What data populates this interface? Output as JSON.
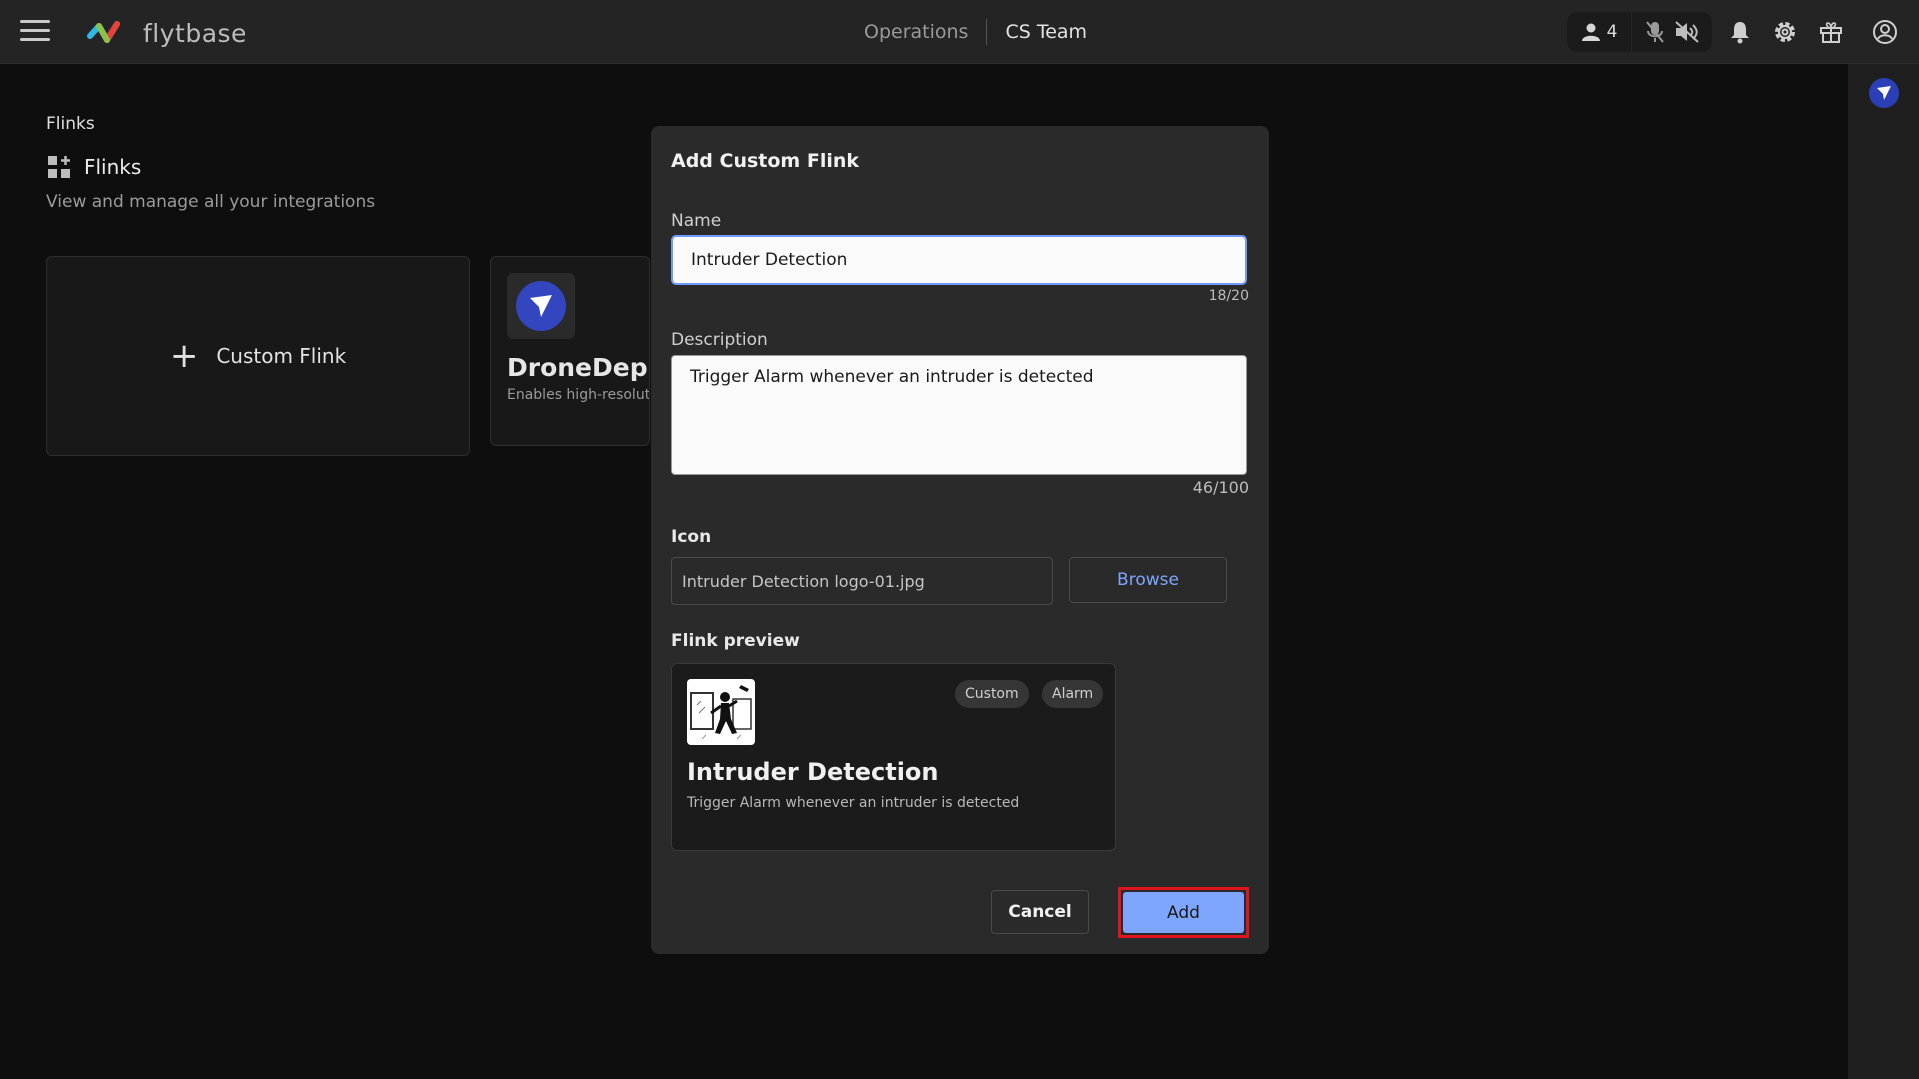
{
  "header": {
    "logo_text": "flytbase",
    "nav_operations": "Operations",
    "nav_team": "CS Team",
    "user_count": "4"
  },
  "page": {
    "breadcrumb": "Flinks",
    "title": "Flinks",
    "subtitle": "View and manage all your integrations"
  },
  "cards": {
    "custom_label": "Custom Flink",
    "dronedeploy_title": "DroneDeploy",
    "dronedeploy_desc": "Enables high-resolution ata analysis"
  },
  "modal": {
    "title": "Add Custom Flink",
    "name_label": "Name",
    "name_value": "Intruder Detection",
    "name_counter": "18/20",
    "description_label": "Description",
    "description_value": "Trigger Alarm whenever an intruder is detected",
    "description_counter": "46/100",
    "icon_label": "Icon",
    "icon_value": "Intruder Detection logo-01.jpg",
    "browse_label": "Browse",
    "preview_label": "Flink preview",
    "preview": {
      "tags": [
        "Custom",
        "Alarm"
      ],
      "title": "Intruder Detection",
      "description": "Trigger Alarm whenever an intruder is detected"
    },
    "cancel_label": "Cancel",
    "add_label": "Add"
  },
  "colors": {
    "accent": "#7ea6ff",
    "highlight": "#e0141c",
    "brand_blue": "#3446bf"
  },
  "icons": [
    "hamburger-menu-icon",
    "flytbase-logo",
    "user-icon",
    "mic-off-icon",
    "speaker-off-icon",
    "bell-icon",
    "gear-icon",
    "gift-icon",
    "account-icon",
    "grid-icon",
    "plus-icon",
    "dronedeploy-icon",
    "intruder-icon"
  ]
}
